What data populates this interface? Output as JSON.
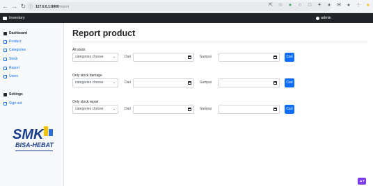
{
  "browser": {
    "back_icon": "back-arrow-icon",
    "forward_icon": "forward-arrow-icon",
    "reload_icon": "reload-icon",
    "url_host": "127.0.0.1:8000",
    "url_path": "/report",
    "url_icon": "info-icon"
  },
  "navbar": {
    "brand": "Inventory",
    "user": "admin"
  },
  "sidebar": {
    "items": [
      {
        "label": "Dashboard",
        "icon": "home-icon"
      },
      {
        "label": "Product",
        "icon": "file-icon"
      },
      {
        "label": "Categories",
        "icon": "list-icon"
      },
      {
        "label": "Stock",
        "icon": "box-icon"
      },
      {
        "label": "Report",
        "icon": "chart-icon"
      },
      {
        "label": "Users",
        "icon": "users-icon"
      },
      {
        "label": "Settings",
        "icon": "gear-icon"
      },
      {
        "label": "Sign out",
        "icon": "exit-icon"
      }
    ],
    "logo_text": "SMK",
    "logo_subtext": "BISA-HEBAT"
  },
  "main": {
    "title": "Report product",
    "sections": [
      {
        "label": "All stock",
        "select": "categories choose",
        "from_label": "Dari",
        "to_label": "Sampai",
        "button": "Cari"
      },
      {
        "label": "Only stock damage",
        "select": "categories choose",
        "from_label": "Dari",
        "to_label": "Sampai",
        "button": "Cari"
      },
      {
        "label": "Only stock repair",
        "select": "categories choose",
        "from_label": "Dari",
        "to_label": "Sampai",
        "button": "Cari"
      }
    ]
  },
  "colors": {
    "primary": "#0d6efd",
    "navbar": "#212529",
    "sidebar": "#f8f9fa",
    "fab": "#7c3aed"
  }
}
